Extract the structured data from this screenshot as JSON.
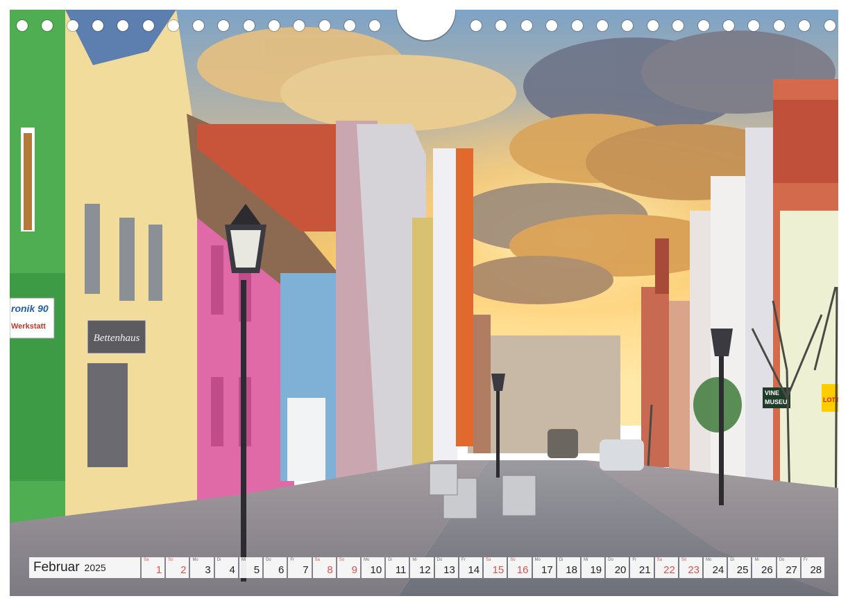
{
  "calendar": {
    "month": "Februar",
    "year": "2025",
    "days": [
      {
        "wd": "Sa",
        "n": "1",
        "weekend": true
      },
      {
        "wd": "So",
        "n": "2",
        "weekend": true
      },
      {
        "wd": "Mo",
        "n": "3",
        "weekend": false
      },
      {
        "wd": "Di",
        "n": "4",
        "weekend": false
      },
      {
        "wd": "Mi",
        "n": "5",
        "weekend": false
      },
      {
        "wd": "Do",
        "n": "6",
        "weekend": false
      },
      {
        "wd": "Fr",
        "n": "7",
        "weekend": false
      },
      {
        "wd": "Sa",
        "n": "8",
        "weekend": true
      },
      {
        "wd": "So",
        "n": "9",
        "weekend": true
      },
      {
        "wd": "Mo",
        "n": "10",
        "weekend": false
      },
      {
        "wd": "Di",
        "n": "11",
        "weekend": false
      },
      {
        "wd": "Mi",
        "n": "12",
        "weekend": false
      },
      {
        "wd": "Do",
        "n": "13",
        "weekend": false
      },
      {
        "wd": "Fr",
        "n": "14",
        "weekend": false
      },
      {
        "wd": "Sa",
        "n": "15",
        "weekend": true
      },
      {
        "wd": "So",
        "n": "16",
        "weekend": true
      },
      {
        "wd": "Mo",
        "n": "17",
        "weekend": false
      },
      {
        "wd": "Di",
        "n": "18",
        "weekend": false
      },
      {
        "wd": "Mi",
        "n": "19",
        "weekend": false
      },
      {
        "wd": "Do",
        "n": "20",
        "weekend": false
      },
      {
        "wd": "Fr",
        "n": "21",
        "weekend": false
      },
      {
        "wd": "Sa",
        "n": "22",
        "weekend": true
      },
      {
        "wd": "So",
        "n": "23",
        "weekend": true
      },
      {
        "wd": "Mo",
        "n": "24",
        "weekend": false
      },
      {
        "wd": "Di",
        "n": "25",
        "weekend": false
      },
      {
        "wd": "Mi",
        "n": "26",
        "weekend": false
      },
      {
        "wd": "Do",
        "n": "27",
        "weekend": false
      },
      {
        "wd": "Fr",
        "n": "28",
        "weekend": false
      }
    ]
  },
  "signs": {
    "bettenhaus": "Bettenhaus",
    "tronik": "ronik 90",
    "werkstatt": "Werkstatt",
    "vine": "VINE",
    "museum": "MUSEU",
    "lotto": "LOTTO"
  },
  "colors": {
    "weekend": "#d9534f",
    "sky_top": "#7fa6c8",
    "sun_glow": "#ffd97a"
  }
}
